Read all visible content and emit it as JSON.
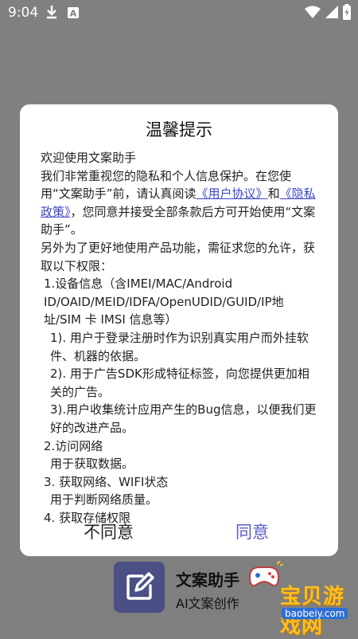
{
  "status_bar": {
    "time": "9:04",
    "icons": [
      "download-icon",
      "a-notification-icon",
      "wifi-icon",
      "signal-icon",
      "battery-icon"
    ]
  },
  "dialog": {
    "title": "温馨提示",
    "intro": "欢迎使用文案助手",
    "para1_a": "我们非常重视您的隐私和个人信息保护。在您使用“文案助手”前，请认真阅读",
    "user_agreement_link": "《用户协议》",
    "and": "和",
    "privacy_link": "《隐私政策》",
    "para1_b": "，您同意并接受全部条款后方可开始使用“文案助手”。",
    "para2": "另外为了更好地使用产品功能，需征求您的允许，获取以下权限：",
    "item1": "1.设备信息（含IMEI/MAC/Android ID/OAID/MEID/IDFA/OpenUDID/GUID/IP地址/SIM 卡 IMSI 信息等）",
    "item1_1": "1). 用户于登录注册时作为识别真实用户而外挂软件、机器的依据。",
    "item1_2": "2). 用于广告SDK形成特征标签，向您提供更加相关的广告。",
    "item1_3": "3).用户收集统计应用产生的Bug信息，以便我们更好的改进产品。",
    "item2": "2.访问网络",
    "item2_desc": "用于获取数据。",
    "item3": "3. 获取网络、WIFI状态",
    "item3_desc": "用于判断网络质量。",
    "item4": "4. 获取存储权限",
    "disagree_label": "不同意",
    "agree_label": "同意"
  },
  "launcher": {
    "app_name": "文案助手",
    "app_subtitle": "AI文案创作",
    "icon": "pencil-icon"
  },
  "watermark": {
    "text": "宝贝游戏网",
    "url": "baobeiy.com"
  },
  "colors": {
    "overlay": "#808080",
    "link": "#3d45c8",
    "agree": "#5a5cc6",
    "app_icon_bg": "#4a4f86"
  }
}
